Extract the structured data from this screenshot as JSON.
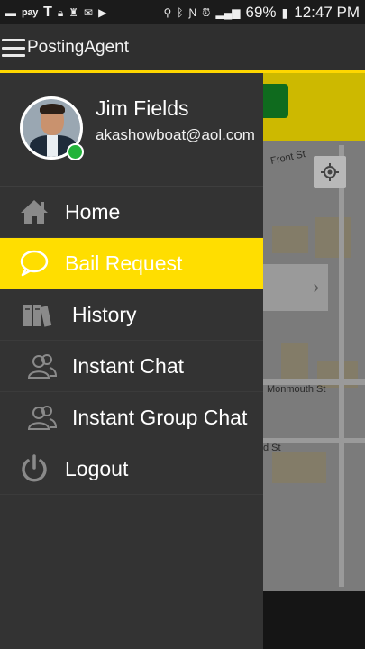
{
  "statusbar": {
    "pay_label": "pay",
    "battery": "69%",
    "time": "12:47 PM"
  },
  "appbar": {
    "title": "PostingAgent"
  },
  "map": {
    "street_1": "Front St",
    "street_2": "Monmouth St",
    "street_3": "d St",
    "card_chevron": "›"
  },
  "profile": {
    "name": "Jim Fields",
    "email": "akashowboat@aol.com",
    "status": "online"
  },
  "menu": {
    "items": [
      {
        "label": "Home",
        "icon": "home-icon"
      },
      {
        "label": "Bail Request",
        "icon": "chat-bubble-icon",
        "active": true
      },
      {
        "label": "History",
        "icon": "books-icon"
      },
      {
        "label": "Instant Chat",
        "icon": "users-icon"
      },
      {
        "label": "Instant Group Chat",
        "icon": "users-icon"
      },
      {
        "label": "Logout",
        "icon": "power-icon"
      }
    ]
  },
  "colors": {
    "accent": "#ffde00",
    "drawer_bg": "#333333",
    "online": "#22b33a"
  }
}
